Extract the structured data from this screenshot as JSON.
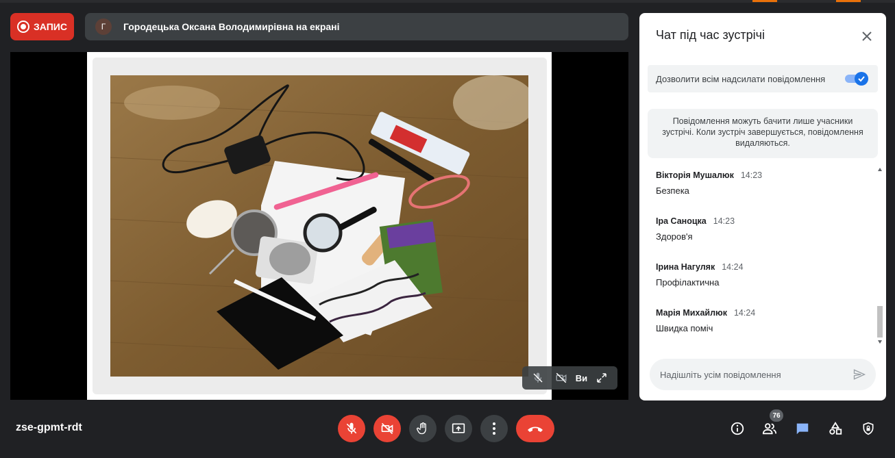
{
  "recording": {
    "label": "ЗАПИС"
  },
  "presenter": {
    "initial": "Г",
    "text": "Городецька Оксана Володимирівна на екрані"
  },
  "tile": {
    "label": "Ви"
  },
  "chat": {
    "title": "Чат під час зустрічі",
    "allow_label": "Дозволити всім надсилати повідомлення",
    "allow_enabled": true,
    "info": "Повідомлення можуть бачити лише учасники зустрічі. Коли зустріч завершується, повідомлення видаляються.",
    "messages": [
      {
        "sender": "Вікторія Мушалюк",
        "time": "14:23",
        "text": "Безпека"
      },
      {
        "sender": "Іра Саноцка",
        "time": "14:23",
        "text": "Здоров'я"
      },
      {
        "sender": "Ірина Нагуляк",
        "time": "14:24",
        "text": "Профілактична"
      },
      {
        "sender": "Марія Михайлюк",
        "time": "14:24",
        "text": "Швидка поміч"
      }
    ],
    "compose_placeholder": "Надішліть усім повідомлення"
  },
  "bottom_bar": {
    "meeting_code": "zse-gpmt-rdt",
    "participants_count": "76"
  },
  "colors": {
    "accent": "#1a73e8",
    "danger": "#ea4335",
    "background": "#202124"
  },
  "icons": [
    "record-icon",
    "mic-off-icon",
    "camera-off-icon",
    "raise-hand-icon",
    "present-icon",
    "more-icon",
    "hangup-icon",
    "info-icon",
    "people-icon",
    "chat-icon",
    "activities-icon",
    "host-controls-icon",
    "close-icon",
    "send-icon",
    "fullscreen-icon"
  ]
}
